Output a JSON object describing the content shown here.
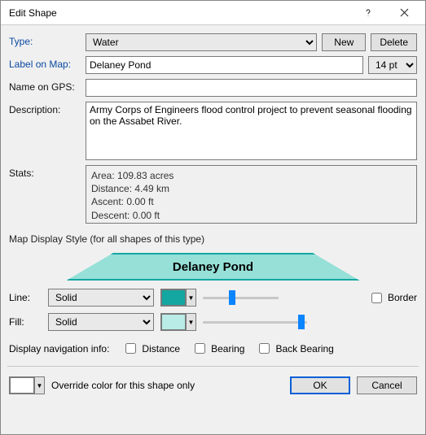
{
  "window": {
    "title": "Edit Shape"
  },
  "labels": {
    "type": "Type:",
    "label_on_map": "Label on Map:",
    "name_on_gps": "Name on GPS:",
    "description": "Description:",
    "stats": "Stats:",
    "group_heading": "Map Display Style (for all shapes of this type)",
    "line": "Line:",
    "fill": "Fill:",
    "border": "Border",
    "nav_info": "Display navigation info:",
    "distance": "Distance",
    "bearing": "Bearing",
    "back_bearing": "Back Bearing",
    "override": "Override color for this shape only"
  },
  "buttons": {
    "new": "New",
    "delete": "Delete",
    "ok": "OK",
    "cancel": "Cancel"
  },
  "values": {
    "type": "Water",
    "label_on_map": "Delaney Pond",
    "font_size": "14 pt",
    "name_on_gps": "",
    "description": "Army Corps of Engineers flood control project to prevent seasonal flooding on the Assabet River.",
    "stats_area": "Area: 109.83 acres",
    "stats_distance": "Distance: 4.49 km",
    "stats_ascent": "Ascent: 0.00 ft",
    "stats_descent": "Descent: 0.00 ft",
    "preview_label": "Delaney Pond",
    "line_style": "Solid",
    "fill_style": "Solid",
    "line_color": "#14a6a0",
    "fill_color": "#b9ece6",
    "override_color": "#ffffff"
  }
}
